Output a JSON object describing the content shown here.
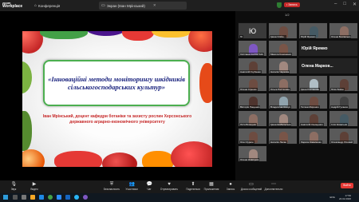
{
  "app": {
    "brand_line1": "zoom",
    "brand_line2": "Workplace"
  },
  "tabs": [
    {
      "label": "Конференція"
    },
    {
      "label": "Экран (Іван Мрінський)"
    }
  ],
  "header": {
    "record_label": "• Запись",
    "page_indicator": "1/2"
  },
  "slide": {
    "title": "«Інноваційні методи моніторингу шкідників сільськогосподарських культур»",
    "author": "Іван Мрінський, доцент кафедри ботаніки та захисту рослин Херсонського державного аграрно-економічного університету"
  },
  "gallery": {
    "tiles": [
      {
        "name": "Ю",
        "initial": "Ю",
        "kind": "initial"
      },
      {
        "name": "Ірина Олійн...",
        "kind": "person",
        "color": "#6d4c41"
      },
      {
        "name": "Юрій Яремко",
        "kind": "person",
        "color": "#455a64"
      },
      {
        "name": "Олена Безпалько",
        "kind": "person",
        "color": "#8d6e63"
      },
      {
        "name": "Світлана КАЛЮГІНА",
        "kind": "person",
        "color": "#7e57c2"
      },
      {
        "name": "Микола Кононенко",
        "kind": "person",
        "color": "#795548"
      },
      {
        "name": "Юрій Яремко",
        "kind": "wide"
      },
      {
        "name": "Анатолій Горбенко",
        "kind": "person",
        "color": "#5d4037"
      },
      {
        "name": "Наталія Черкова",
        "kind": "person",
        "color": "#a1887f"
      },
      {
        "name": "Олена Марков...",
        "kind": "wide"
      },
      {
        "name": "Олена Сіренко",
        "kind": "person",
        "color": "#6d4c41"
      },
      {
        "name": "Ольга Ростянова",
        "kind": "person",
        "color": "#8d6e63"
      },
      {
        "name": "Ірина Ростянова",
        "kind": "person",
        "color": "#b0bec5"
      },
      {
        "name": "Юлія Бойко",
        "kind": "person",
        "color": "#5d4037"
      },
      {
        "name": "Вікторія Пащенко",
        "kind": "person",
        "color": "#4e342e"
      },
      {
        "name": "Владислав Ємчук",
        "kind": "person",
        "color": "#90a4ae"
      },
      {
        "name": "Тетяна Миронко",
        "kind": "person",
        "color": "#6d4c41"
      },
      {
        "name": "Андрій Гусаков",
        "kind": "person",
        "color": "#424242"
      },
      {
        "name": "Ліл'я Білецька",
        "kind": "person",
        "color": "#8d6e63"
      },
      {
        "name": "Ірина Шабельська",
        "kind": "person",
        "color": "#a1887f"
      },
      {
        "name": "Анатолій Онищенко",
        "kind": "person",
        "color": "#5d4037"
      },
      {
        "name": "Ілля Ковальов",
        "kind": "person",
        "color": "#455a64"
      },
      {
        "name": "Олег Курнін",
        "kind": "person",
        "color": "#6d4c41"
      },
      {
        "name": "Наталія Лисак",
        "kind": "person",
        "color": "#795548"
      },
      {
        "name": "Лариса Коваленко",
        "kind": "person",
        "color": "#8d6e63"
      },
      {
        "name": "Олександр Лісовий",
        "kind": "person",
        "color": "#5d4037"
      },
      {
        "name": "Олена Новицька",
        "kind": "person",
        "color": "#a1887f"
      }
    ]
  },
  "toolbar": {
    "items": [
      {
        "label": "Звук",
        "icon": "microphone-icon",
        "glyph": "🎙"
      },
      {
        "label": "Видео",
        "icon": "video-icon",
        "glyph": "▶"
      },
      {
        "label": "Безопасность",
        "icon": "shield-icon",
        "glyph": "⛨"
      },
      {
        "label": "Участники",
        "icon": "participants-icon",
        "glyph": "👥"
      },
      {
        "label": "Чат",
        "icon": "chat-icon",
        "glyph": "💬"
      },
      {
        "label": "Отреагировать",
        "icon": "react-icon",
        "glyph": "♥"
      },
      {
        "label": "Поделиться",
        "icon": "share-icon",
        "glyph": "⬆"
      },
      {
        "label": "Приложения",
        "icon": "apps-icon",
        "glyph": "▦"
      },
      {
        "label": "Запись",
        "icon": "record-icon",
        "glyph": "●"
      },
      {
        "label": "Доска сообщений",
        "icon": "whiteboard-icon",
        "glyph": "▭"
      },
      {
        "label": "Дополнительно",
        "icon": "more-icon",
        "glyph": "⋯"
      }
    ],
    "end_label": "Выйти"
  },
  "taskbar": {
    "lang": "ENG",
    "time": "17:56",
    "date": "24.02.2026"
  },
  "colors": {
    "accent": "#2d8cff",
    "end": "#e53935",
    "title_border": "#4caf50",
    "title_text": "#1a237e",
    "author_text": "#c62828"
  }
}
